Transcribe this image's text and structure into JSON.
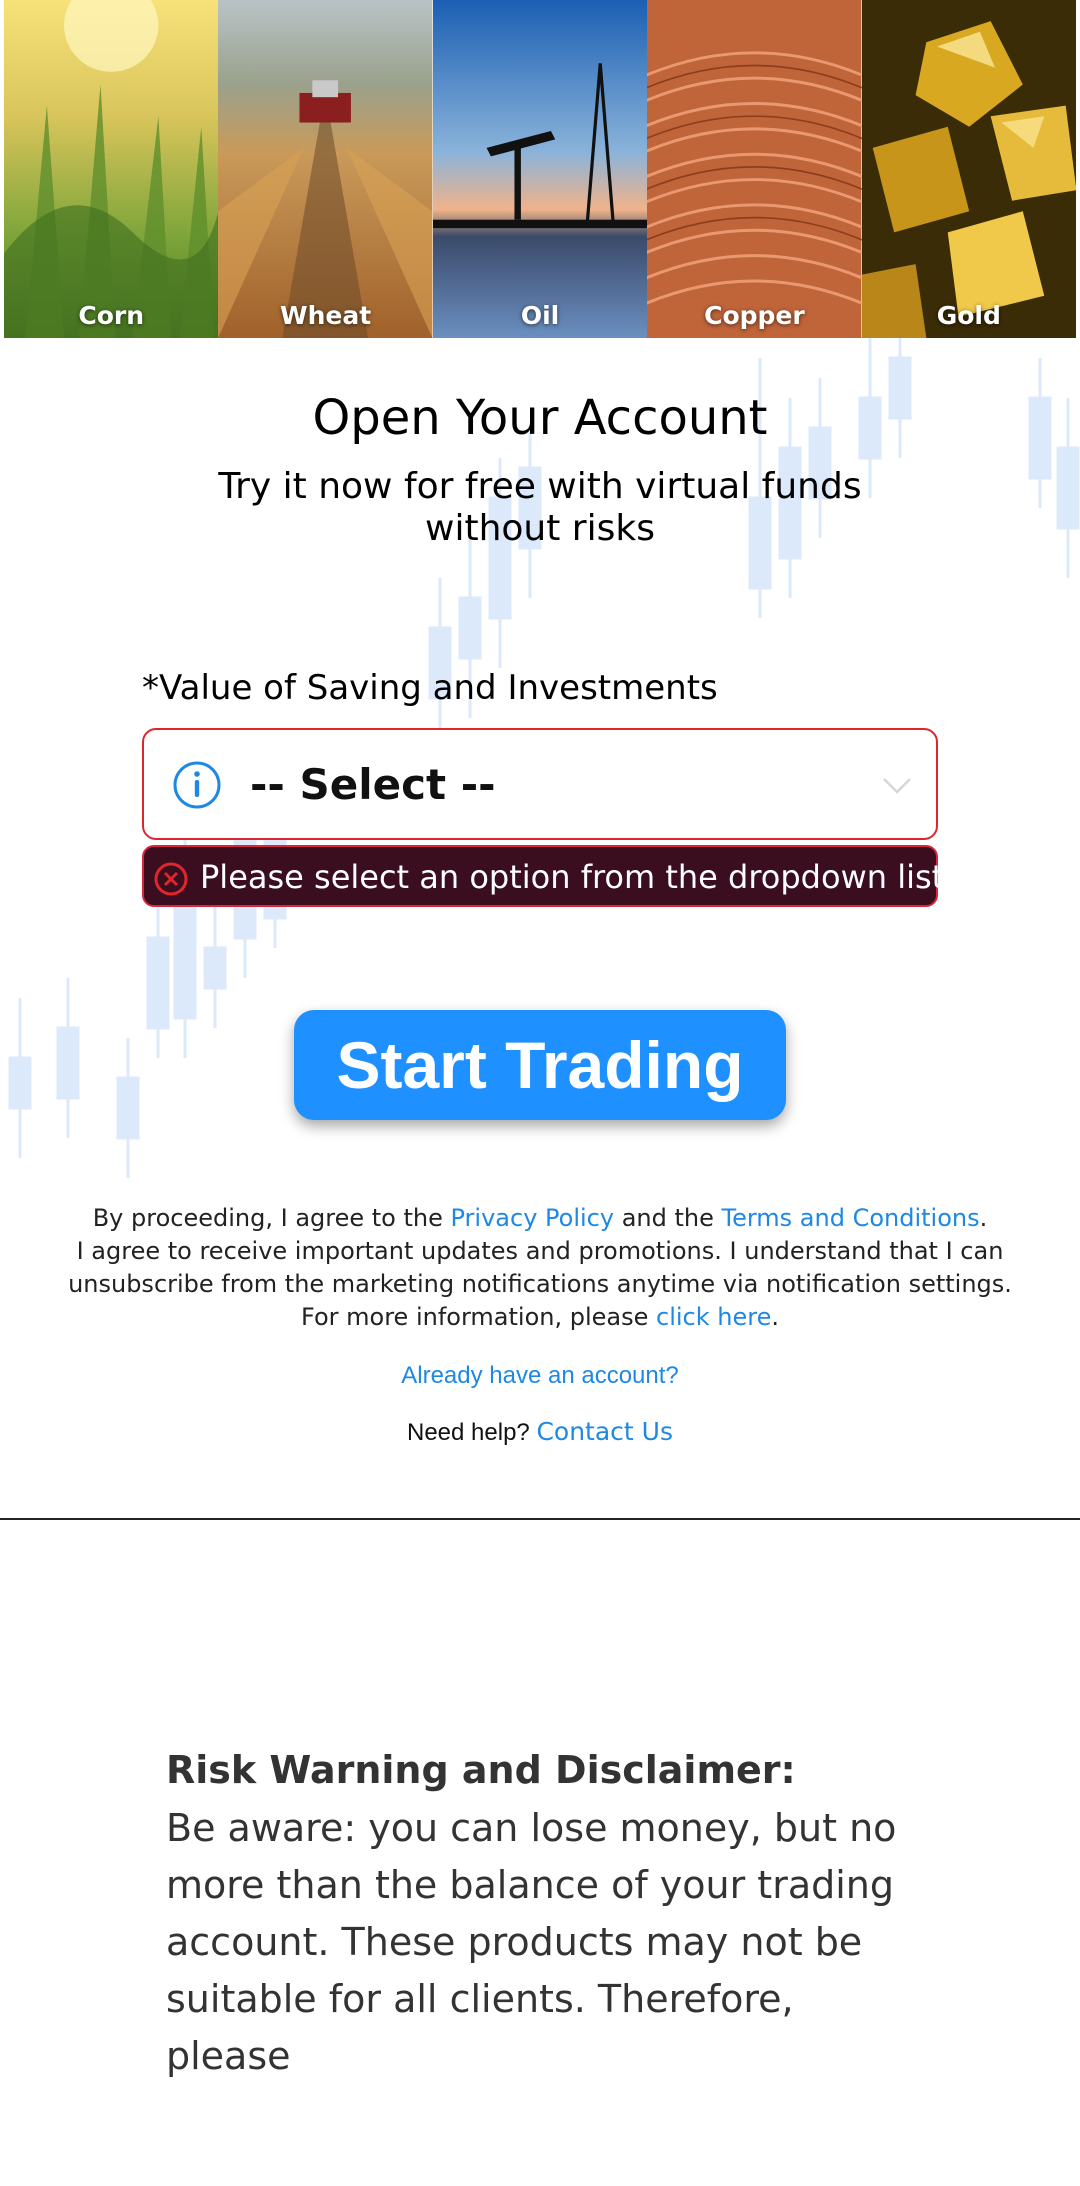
{
  "banner": {
    "tiles": [
      {
        "label": "Corn",
        "icon": "corn-image"
      },
      {
        "label": "Wheat",
        "icon": "wheat-harvester-image"
      },
      {
        "label": "Oil",
        "icon": "oil-rig-image"
      },
      {
        "label": "Copper",
        "icon": "copper-wire-image"
      },
      {
        "label": "Gold",
        "icon": "gold-nuggets-image"
      }
    ]
  },
  "header": {
    "title": "Open Your Account",
    "subtitle_line1": "Try it now for free with virtual funds",
    "subtitle_line2": "without risks"
  },
  "form": {
    "field_label": "*Value of Saving and Investments",
    "select_value": "-- Select --",
    "error_message": "Please select an option from the dropdown list.",
    "submit_label": "Start Trading",
    "colors": {
      "error_border": "#e0262d",
      "error_background": "#3a0d1f",
      "button": "#1e90ff",
      "link": "#1e88e5"
    }
  },
  "legal": {
    "line1_prefix": "By proceeding, I agree to the ",
    "privacy_link": "Privacy Policy",
    "line1_mid": " and the ",
    "terms_link": "Terms and Conditions",
    "line1_suffix": ".",
    "line2": "I agree to receive important updates and promotions. I understand that I can",
    "line3": "unsubscribe from the marketing notifications anytime via notification settings.",
    "line4_prefix": "For more information, please ",
    "click_here_link": "click here",
    "line4_suffix": "."
  },
  "footer": {
    "already_account": "Already have an account?",
    "help_prefix": "Need help? ",
    "contact_link": "Contact Us"
  },
  "risk": {
    "title": "Risk Warning and Disclaimer:",
    "body_line1": "Be aware: you can lose money, but no",
    "body_line2": "more than the balance of your trading",
    "body_line3": "account. These products may not be",
    "body_line4": "suitable for all clients. Therefore, please"
  }
}
